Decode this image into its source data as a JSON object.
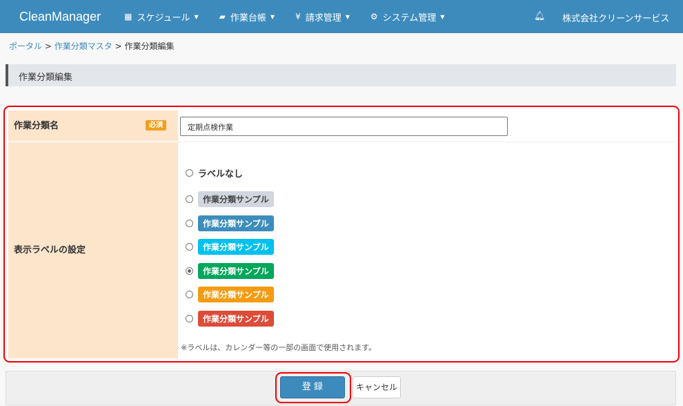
{
  "nav": {
    "brand": "CleanManager",
    "menus": [
      {
        "icon": "calendar-icon",
        "glyph": "▦",
        "label": "スケジュール"
      },
      {
        "icon": "book-icon",
        "glyph": "▰",
        "label": "作業台帳"
      },
      {
        "icon": "yen-icon",
        "glyph": "¥",
        "label": "請求管理"
      },
      {
        "icon": "gears-icon",
        "glyph": "⚙",
        "label": "システム管理"
      }
    ],
    "company": "株式会社クリーンサービス"
  },
  "breadcrumb": {
    "items": [
      "ポータル",
      "作業分類マスタ"
    ],
    "current": "作業分類編集",
    "sep": ">"
  },
  "page_title": "作業分類編集",
  "form": {
    "name_label": "作業分類名",
    "required": "必須",
    "name_value": "定期点検作業",
    "label_setting": "表示ラベルの設定",
    "none_option": "ラベルなし",
    "options": [
      {
        "text": "作業分類サンプル",
        "color": "#d2d6de",
        "fg": "#444"
      },
      {
        "text": "作業分類サンプル",
        "color": "#3c8dbc",
        "fg": "#fff"
      },
      {
        "text": "作業分類サンプル",
        "color": "#00c0ef",
        "fg": "#fff"
      },
      {
        "text": "作業分類サンプル",
        "color": "#00a65a",
        "fg": "#fff"
      },
      {
        "text": "作業分類サンプル",
        "color": "#f39c12",
        "fg": "#fff"
      },
      {
        "text": "作業分類サンプル",
        "color": "#dd4b39",
        "fg": "#fff"
      }
    ],
    "selected_index": 3,
    "note": "※ラベルは、カレンダー等の一部の画面で使用されます。"
  },
  "buttons": {
    "save": "登 録",
    "cancel": "キャンセル"
  }
}
